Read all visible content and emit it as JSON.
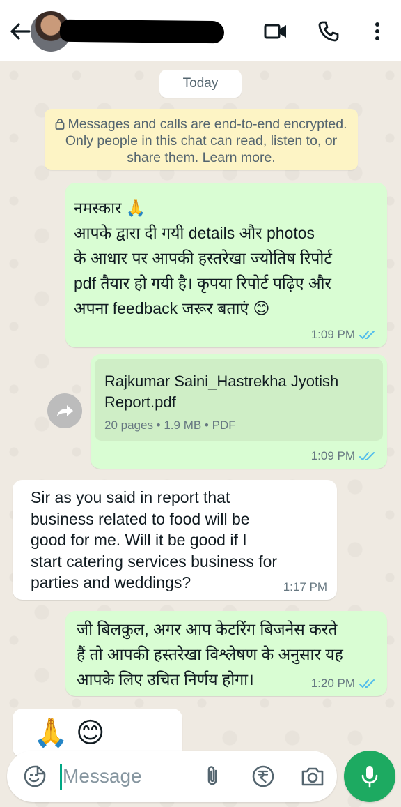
{
  "header": {
    "contact_name_redacted": true
  },
  "chat": {
    "day_label": "Today",
    "encryption_notice": "Messages and calls are end-to-end encrypted. Only people in this chat can read, listen to, or share them. Learn more.",
    "messages": [
      {
        "direction": "outgoing",
        "lines": [
          "नमस्कार 🙏",
          "आपके द्वारा दी गयी details और photos",
          "के आधार पर आपकी हस्तरेखा ज्योतिष रिपोर्ट",
          "pdf तैयार हो गयी है। कृपया रिपोर्ट पढ़िए और",
          "अपना feedback जरूर बताएं 😊"
        ],
        "time": "1:09 PM",
        "status": "read"
      },
      {
        "direction": "outgoing",
        "document": {
          "title_line1": "Rajkumar Saini_Hastrekha Jyotish",
          "title_line2": "Report.pdf",
          "info": "20 pages • 1.9 MB • PDF"
        },
        "time": "1:09 PM",
        "status": "read"
      },
      {
        "direction": "incoming",
        "lines": [
          "Sir as you said in report that",
          "business related to food will be",
          "good for me. Will it be good if I",
          "start catering services business for",
          "parties and weddings?"
        ],
        "time": "1:17 PM"
      },
      {
        "direction": "outgoing",
        "lines": [
          "जी बिलकुल, अगर आप केटरिंग बिजनेस करते",
          "हैं तो आपकी हस्तरेखा विश्लेषण के अनुसार यह",
          "आपके लिए उचित निर्णय होगा।"
        ],
        "time": "1:20 PM",
        "status": "read"
      },
      {
        "direction": "incoming",
        "lines": [
          "🙏 😊"
        ]
      }
    ]
  },
  "composer": {
    "placeholder": "Message"
  },
  "colors": {
    "outgoing_bubble": "#d9fdd3",
    "incoming_bubble": "#ffffff",
    "read_ticks": "#53bdeb",
    "mic_button": "#1daa61"
  },
  "icons": [
    "back-arrow-icon",
    "video-call-icon",
    "phone-icon",
    "more-options-icon",
    "lock-icon",
    "forward-icon",
    "double-check-icon",
    "emoji-icon",
    "attach-icon",
    "rupee-icon",
    "camera-icon",
    "mic-icon"
  ]
}
